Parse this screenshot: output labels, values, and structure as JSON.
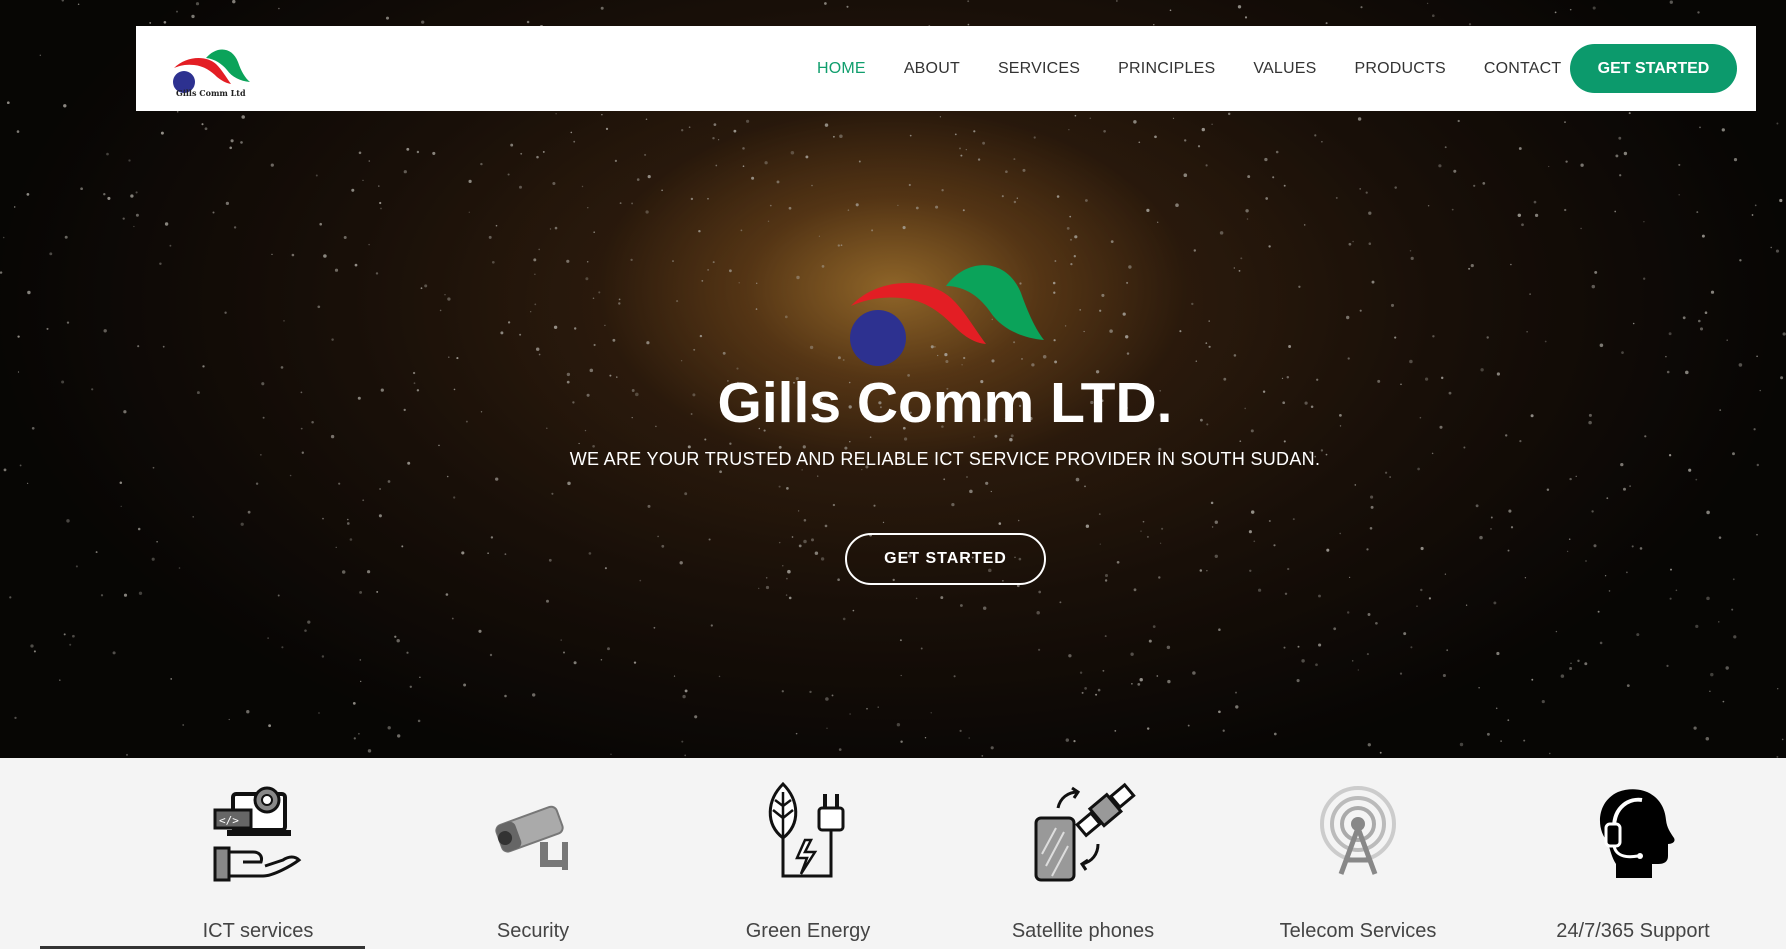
{
  "brand": {
    "logo_text": "Gills Comm Ltd",
    "colors": {
      "green": "#0ba35a",
      "red": "#e31e24",
      "blue": "#2d3190",
      "accent": "#0c9a6c"
    }
  },
  "nav": {
    "items": [
      {
        "label": "HOME",
        "active": true
      },
      {
        "label": "ABOUT",
        "active": false
      },
      {
        "label": "SERVICES",
        "active": false
      },
      {
        "label": "PRINCIPLES",
        "active": false
      },
      {
        "label": "VALUES",
        "active": false
      },
      {
        "label": "PRODUCTS",
        "active": false
      },
      {
        "label": "CONTACT",
        "active": false
      }
    ],
    "cta": "GET STARTED"
  },
  "hero": {
    "title": "Gills Comm LTD.",
    "subtitle": "WE ARE YOUR TRUSTED AND RELIABLE ICT SERVICE PROVIDER IN SOUTH SUDAN.",
    "cta": "GET STARTED"
  },
  "services": [
    {
      "label": "ICT services",
      "icon": "ict-services-icon"
    },
    {
      "label": "Security",
      "icon": "security-camera-icon"
    },
    {
      "label": "Green Energy",
      "icon": "green-energy-icon"
    },
    {
      "label": "Satellite phones",
      "icon": "satellite-phone-icon"
    },
    {
      "label": "Telecom Services",
      "icon": "telecom-tower-icon"
    },
    {
      "label": "24/7/365 Support",
      "icon": "support-headset-icon"
    }
  ]
}
